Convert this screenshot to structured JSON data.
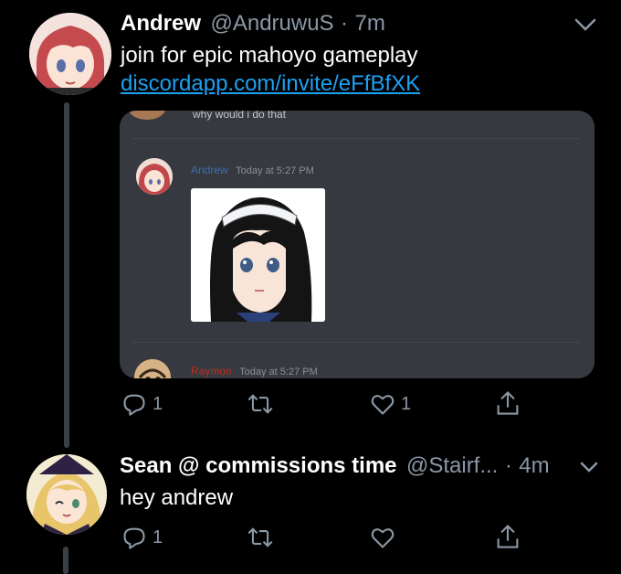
{
  "tweet1": {
    "name": "Andrew",
    "handle": "@AndruwuS",
    "separator": "·",
    "time": "7m",
    "text": "join for epic mahoyo gameplay",
    "link": "discordapp.com/invite/eFfBfXK",
    "replies": "1",
    "likes": "1"
  },
  "embed": {
    "top_message": "why would i do that",
    "msg1_author": "Andrew",
    "msg1_time": "Today at 5:27 PM",
    "msg2_author": "Raymoo",
    "msg2_time": "Today at 5:27 PM"
  },
  "tweet2": {
    "name": "Sean @ commissions time",
    "handle": "@Stairf...",
    "separator": "·",
    "time": "4m",
    "text": "hey andrew",
    "replies": "1"
  },
  "colors": {
    "background": "#000000",
    "link": "#1da1f2",
    "secondary": "#8b98a5",
    "embed_bg": "#36393f",
    "discord_author_blue": "#3a6fb0",
    "discord_author_red": "#b8311f"
  }
}
